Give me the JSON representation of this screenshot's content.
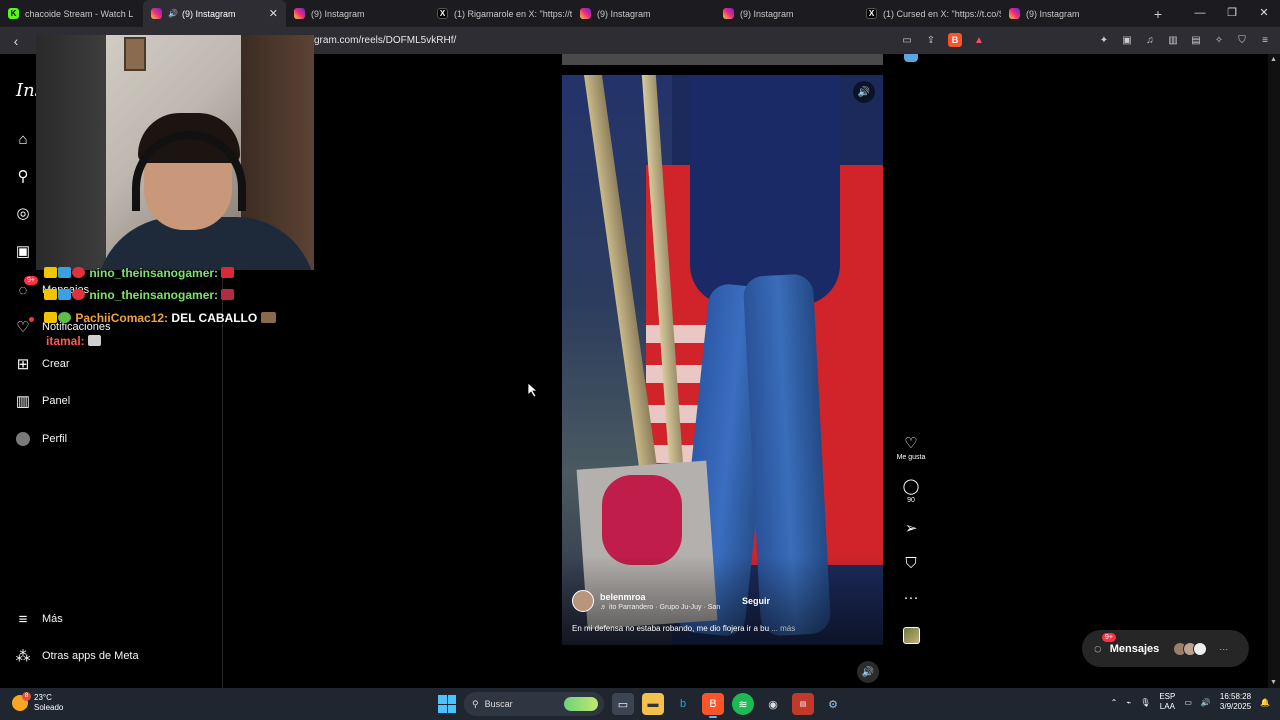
{
  "browser": {
    "tabs": [
      {
        "favicon": "kick",
        "title": "chacoide Stream - Watch L",
        "active": false
      },
      {
        "favicon": "instagram",
        "title": "(9) Instagram",
        "active": true,
        "audio": true
      },
      {
        "favicon": "instagram",
        "title": "(9) Instagram",
        "active": false
      },
      {
        "favicon": "x",
        "title": "(1) Rigamarole en X: \"https://t",
        "active": false
      },
      {
        "favicon": "instagram",
        "title": "(9) Instagram",
        "active": false
      },
      {
        "favicon": "instagram",
        "title": "(9) Instagram",
        "active": false
      },
      {
        "favicon": "x",
        "title": "(1) Cursed en X: \"https://t.co/S",
        "active": false
      },
      {
        "favicon": "instagram",
        "title": "(9) Instagram",
        "active": false
      }
    ],
    "url": "gram.com/reels/DOFML5vkRHf/",
    "brave_rewards_badge": "1"
  },
  "sidebar": {
    "logo": "Ins",
    "items": [
      {
        "icon": "home-icon",
        "label": ""
      },
      {
        "icon": "search-icon",
        "label": ""
      },
      {
        "icon": "explore-icon",
        "label": ""
      },
      {
        "icon": "reels-icon",
        "label": ""
      },
      {
        "icon": "messenger-icon",
        "label": "Mensajes",
        "badge": "9+"
      },
      {
        "icon": "heart-icon",
        "label": "Notificaciones"
      },
      {
        "icon": "plus-square-icon",
        "label": "Crear"
      },
      {
        "icon": "dashboard-icon",
        "label": "Panel"
      },
      {
        "icon": "profile-avatar",
        "label": "Perfil"
      }
    ],
    "bottom": [
      {
        "icon": "menu-icon",
        "label": "Más"
      },
      {
        "icon": "meta-apps-icon",
        "label": "Otras apps de Meta"
      }
    ]
  },
  "chat": [
    {
      "user": "nino_theinsanogamer:",
      "message": "",
      "color": "#7ee36b"
    },
    {
      "user": "nino_theinsanogamer:",
      "message": "",
      "color": "#7ee36b"
    },
    {
      "user": "PachiiComac12:",
      "message": "DEL CABALLO",
      "color": "#f2a23a"
    },
    {
      "user": "itamal:",
      "message": "",
      "color": "#ff5a5a"
    }
  ],
  "reel": {
    "username": "belenmroa",
    "follow": "Seguir",
    "audio": "♬ ito Parrandero · Grupo Ju-Juy · San",
    "caption": "En mi defensa no estaba robando, me dio flojera ir a bu",
    "caption_more": "... más"
  },
  "actions": {
    "like": "Me gusta",
    "comments": "90"
  },
  "messages_pill": {
    "label": "Mensajes",
    "badge": "9+"
  },
  "taskbar": {
    "weather_temp": "23°C",
    "weather_desc": "Soleado",
    "weather_badge": "8",
    "search_placeholder": "Buscar",
    "lang_top": "ESP",
    "lang_bottom": "LAA",
    "time": "16:58:28",
    "date": "3/9/2025"
  }
}
